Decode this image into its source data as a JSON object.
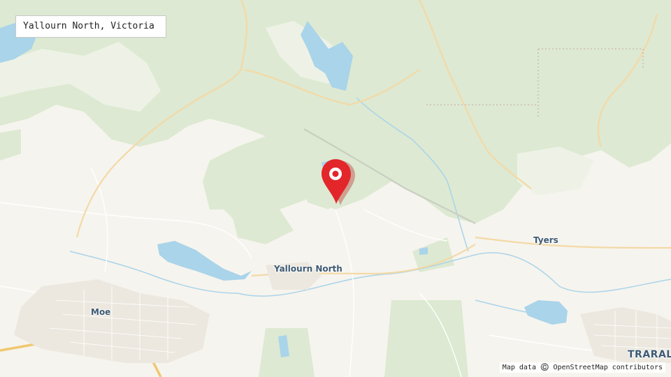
{
  "map": {
    "title": "Yallourn North, Victoria",
    "places": {
      "yallourn_north": "Yallourn North",
      "tyers": "Tyers",
      "moe": "Moe",
      "traralgon": "TRARAL"
    },
    "attribution": "Map data ©️ OpenStreetMap contributors",
    "marker_icon": "map-pin-icon",
    "colors": {
      "land": "#f6f4ee",
      "forest": "#dbe8d0",
      "water": "#a9d4ea",
      "road": "#f3d9a6",
      "marker": "#e3262a"
    }
  }
}
